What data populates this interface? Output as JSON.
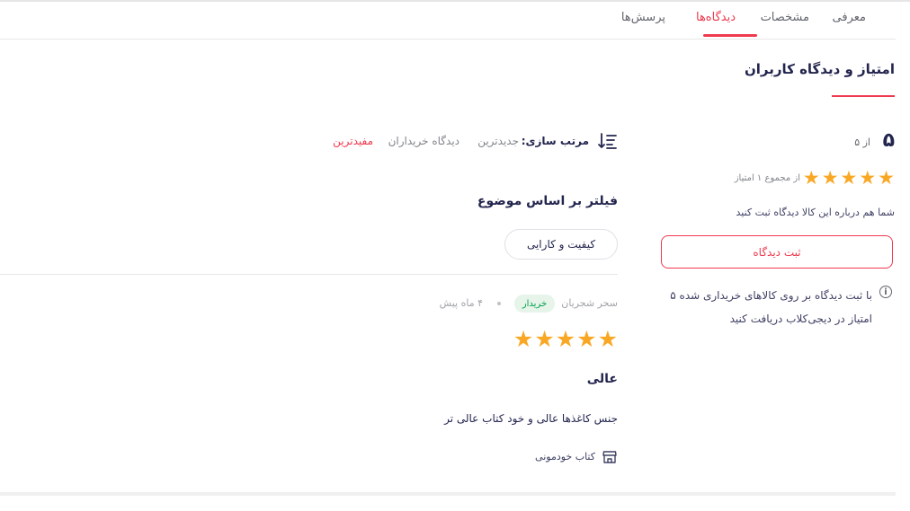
{
  "tabs": [
    {
      "label": "معرفی",
      "active": false
    },
    {
      "label": "مشخصات",
      "active": false
    },
    {
      "label": "دیدگاه‌ها",
      "active": true
    },
    {
      "label": "پرسش‌ها",
      "active": false
    }
  ],
  "summary": {
    "section_title": "امتیاز و دیدگاه کاربران",
    "score": "۵",
    "score_of": "از ۵",
    "stars": 5,
    "rating_count": "از مجموع ۱ امتیاز",
    "prompt": "شما هم درباره این کالا دیدگاه ثبت کنید",
    "submit_label": "ثبت دیدگاه",
    "info_icon": "i",
    "info_text": "با ثبت دیدگاه بر روی کالاهای خریداری شده ۵ امتیاز در دیجی‌کلاب دریافت کنید"
  },
  "sort": {
    "label": "مرتب سازی:",
    "options": [
      {
        "label": "جدیدترین",
        "active": false
      },
      {
        "label": "دیدگاه خریداران",
        "active": false
      },
      {
        "label": "مفیدترین",
        "active": true
      }
    ]
  },
  "filter": {
    "title": "فیلتر بر اساس موضوع",
    "chips": [
      "کیفیت و کارایی"
    ]
  },
  "review": {
    "author": "سحر شجریان",
    "badge": "خریدار",
    "date": "۴ ماه پیش",
    "stars": 5,
    "title": "عالی",
    "body": "جنس کاغذها عالی و خود کتاب عالی تر",
    "seller": "کتاب خودمونی"
  },
  "colors": {
    "accent": "#ef394e",
    "star": "#f9a825",
    "buyer_badge_bg": "#e6f4ea",
    "buyer_badge_text": "#00a049"
  },
  "icons": {
    "sort": "sort-icon",
    "info": "info-icon",
    "star": "star-icon",
    "shop": "shop-icon"
  }
}
